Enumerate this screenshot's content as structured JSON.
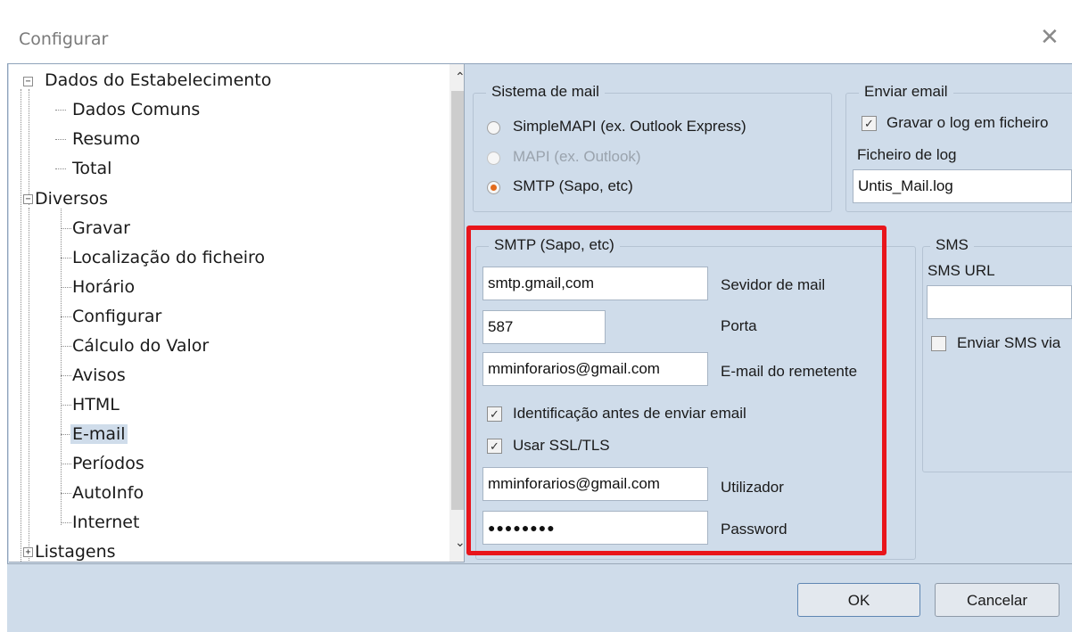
{
  "window": {
    "title": "Configurar",
    "close_glyph": "✕"
  },
  "tree": {
    "items": [
      {
        "label": "Dados do Estabelecimento",
        "level": 0,
        "expander": "−"
      },
      {
        "label": "Dados Comuns",
        "level": 1
      },
      {
        "label": "Resumo",
        "level": 1
      },
      {
        "label": "Total",
        "level": 1
      },
      {
        "label": "Diversos",
        "level": 0,
        "expander": "−"
      },
      {
        "label": "Gravar",
        "level": 1
      },
      {
        "label": "Localização do ficheiro",
        "level": 1
      },
      {
        "label": "Horário",
        "level": 1
      },
      {
        "label": "Configurar",
        "level": 1
      },
      {
        "label": "Cálculo do Valor",
        "level": 1
      },
      {
        "label": "Avisos",
        "level": 1
      },
      {
        "label": "HTML",
        "level": 1
      },
      {
        "label": "E-mail",
        "level": 1,
        "selected": true
      },
      {
        "label": "Períodos",
        "level": 1
      },
      {
        "label": "AutoInfo",
        "level": 1
      },
      {
        "label": "Internet",
        "level": 1
      },
      {
        "label": "Listagens",
        "level": 0,
        "expander": "+"
      }
    ],
    "scroll_up": "⌃",
    "scroll_down": "⌄"
  },
  "mail_system": {
    "legend": "Sistema de mail",
    "options": [
      {
        "label": "SimpleMAPI (ex. Outlook Express)",
        "selected": false,
        "disabled": false
      },
      {
        "label": "MAPI (ex. Outlook)",
        "selected": false,
        "disabled": true
      },
      {
        "label": "SMTP (Sapo, etc)",
        "selected": true,
        "disabled": false
      }
    ]
  },
  "send_email": {
    "legend": "Enviar email",
    "log_checkbox_label": "Gravar o log em ficheiro",
    "log_checked": true,
    "log_file_label": "Ficheiro de log",
    "log_file_value": "Untis_Mail.log"
  },
  "smtp": {
    "legend": "SMTP (Sapo, etc)",
    "server_value": "smtp.gmail,com",
    "server_label": "Sevidor de mail",
    "port_value": "587",
    "port_label": "Porta",
    "sender_value": "mminforarios@gmail.com",
    "sender_label": "E-mail do remetente",
    "auth_label": "Identificação antes de enviar email",
    "auth_checked": true,
    "ssl_label": "Usar SSL/TLS",
    "ssl_checked": true,
    "user_value": "mminforarios@gmail.com",
    "user_label": "Utilizador",
    "password_value": "●●●●●●●●",
    "password_label": "Password"
  },
  "sms": {
    "legend": "SMS",
    "url_label": "SMS URL",
    "url_value": "",
    "via_label": "Enviar SMS via",
    "via_checked": false
  },
  "buttons": {
    "ok": "OK",
    "cancel": "Cancelar"
  },
  "check_glyph": "✓"
}
